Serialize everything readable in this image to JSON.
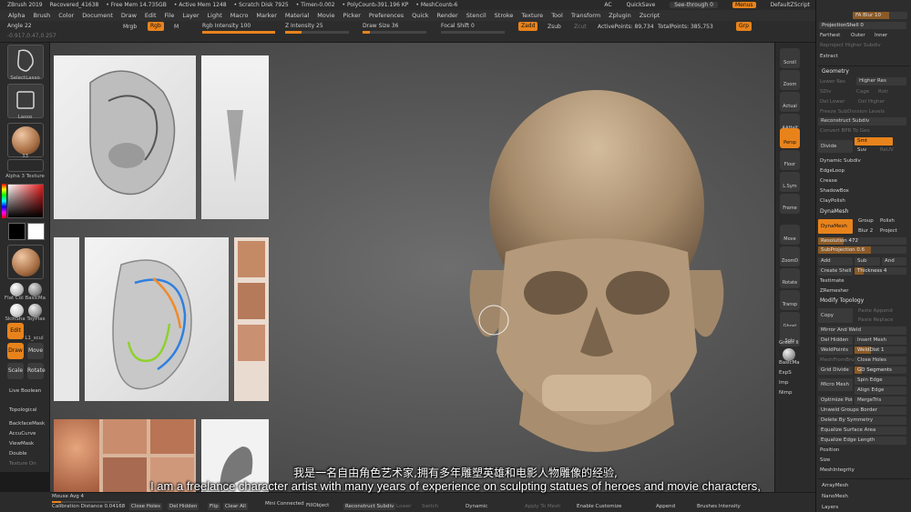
{
  "titlebar": {
    "items": [
      "ZBrush 2019",
      "Recovered_41638",
      "• Free Mem 14.735GB",
      "• Active Mem 1248",
      "• Scratch Disk 7925",
      "• Timer▹0.002",
      "• PolyCount▹391.196 KP",
      "• MeshCount▹6"
    ],
    "ac": "AC",
    "quicksave": "QuickSave",
    "see_through": "See-through  0",
    "menus": "Menus",
    "script": "DefaultZScript"
  },
  "menubar": [
    "Alpha",
    "Brush",
    "Color",
    "Document",
    "Draw",
    "Edit",
    "File",
    "Layer",
    "Light",
    "Macro",
    "Marker",
    "Material",
    "Movie",
    "Picker",
    "Preferences",
    "Quick",
    "Render",
    "Stencil",
    "Stroke",
    "Texture",
    "Tool",
    "Transform",
    "Zplugin",
    "Zscript"
  ],
  "toolbar": {
    "angle": "Angle 22",
    "coords": "-0.917,0.47,0.257",
    "mrgb": "Mrgb",
    "rgb": "Rgb",
    "m": "M",
    "rgb_intensity": "Rgb Intensity 100",
    "rgb_intensity_value": 100,
    "z_intensity": "Z Intensity 25",
    "z_intensity_value": 25,
    "draw_size": "Draw Size 36",
    "focal_shift": "Focal Shift 0",
    "zadd": "Zadd",
    "zsub": "Zsub",
    "zcut": "Zcut",
    "active_points": "ActivePoints: 89,734",
    "total_points": "TotalPoints: 385,753",
    "grp": "Grp"
  },
  "left_shelf": {
    "select_lasso": "SelectLasso",
    "lasso": "Lasso",
    "stroke_count": "33",
    "alpha_label": "Alpha 3 Texture",
    "material_label": "Flat Col BasicMa",
    "material2_label": "SkinSha ToyPlas",
    "model_label": "L1_scul",
    "edit": "Edit",
    "draw": "Draw",
    "move": "Move",
    "scale": "Scale",
    "rotate": "Rotate",
    "live_boolean": "Live Boolean",
    "topological": "Topological",
    "backface_mask": "BackfaceMask",
    "accucurve": "AccuCurve",
    "viewmask": "ViewMask",
    "double": "Double",
    "texture_on": "Texture On"
  },
  "right_shelf": {
    "items": [
      "Scroll",
      "Zoom",
      "Actual",
      "AAHalf",
      "Persp",
      "Floor",
      "L.Sym",
      "Frame",
      "Move",
      "ZoomD",
      "Rotate",
      "Transp",
      "Ghost",
      "Solo"
    ],
    "green_label": "Green II",
    "basic_label": "BasicMa",
    "expl": "ExpS",
    "imp": "Imp",
    "nimp": "Nimp"
  },
  "right_panel": {
    "fablur": "FA Blur 10",
    "projection_shell": "ProjectionShell 0",
    "farthest": "Farthest",
    "outer": "Outer",
    "inner": "Inner",
    "reproject": "Reproject Higher Subdiv",
    "extract": "Extract",
    "geometry": "Geometry",
    "lower_res": "Lower Res",
    "higher_res": "Higher Res",
    "sdiv": "SDiv",
    "cage": "Cage",
    "rstr": "Rstr",
    "del_lower": "Del Lower",
    "del_higher": "Del Higher",
    "freeze": "Freeze SubDivision Levels",
    "reconstruct": "Reconstruct Subdiv",
    "convert_bpr": "Convert BPR To Geo",
    "divide": "Divide",
    "smt": "Smt",
    "suv": "Suv",
    "reuv": "ReUV",
    "dynamic_subdiv": "Dynamic Subdiv",
    "edgeloop": "EdgeLoop",
    "crease": "Crease",
    "shadowbox": "ShadowBox",
    "claypolish": "ClayPolish",
    "dynamesh": "DynaMesh",
    "dynamesh_btn": "DynaMesh",
    "group": "Group",
    "polish": "Polish",
    "blur": "Blur 2",
    "project": "Project",
    "resolution": "Resolution 472",
    "resolution_value": 472,
    "subprojection": "SubProjection 0.6",
    "subprojection_value": 0.6,
    "add": "Add",
    "sub": "Sub",
    "and": "And",
    "create_shell": "Create Shell",
    "thickness": "Thickness 4",
    "testimate": "Testimate",
    "zremesher": "ZRemesher",
    "modify_topology": "Modify Topology",
    "copy": "Copy",
    "paste_append": "Paste Append",
    "paste_replace": "Paste Replace",
    "mirror_weld": "Mirror And Weld",
    "del_hidden": "Del Hidden",
    "insert_mesh": "Insert Mesh",
    "weldpoints": "WeldPoints",
    "welddist": "WeldDist 1",
    "meshfrombrush": "MeshFromBrush",
    "close_holes": "Close Holes",
    "grid_divide": "Grid Divide",
    "gd_segments": "GD Segments",
    "micro_mesh": "Micro Mesh",
    "spin_edge": "Spin Edge",
    "align_edge": "Align Edge",
    "optimize_points": "Optimize Points",
    "mergetris": "MergeTris",
    "unweld_groups": "Unweld Groups Border",
    "delete_by_symmetry": "Delete By Symmetry",
    "equalize_surface": "Equalize Surface Area",
    "equalize_edge": "Equalize Edge Length",
    "position": "Position",
    "size": "Size",
    "meshintegrity": "MeshIntegrity",
    "arraymesh": "ArrayMesh",
    "nanomesh": "NanoMesh",
    "layers": "Layers"
  },
  "bottombar": {
    "mouse_avg": "Mouse Avg 4",
    "calibration": "Calibration Distance 0.04168",
    "close_holes": "Close Holes",
    "del_hidden": "Del Hidden",
    "flip": "Flip",
    "clear_all": "Clear All",
    "mini_connected": "Mini Connected",
    "fill_object": "FillObject",
    "reconstruct": "Reconstruct Subdiv",
    "lower": "Lower",
    "switch": "Switch",
    "dynamic": "Dynamic",
    "apply_to_mesh": "Apply To Mesh",
    "enable_customize": "Enable Customize",
    "append": "Append",
    "brushes_intensity": "Brushes Intensity"
  },
  "subtitles": {
    "chinese": "我是一名自由角色艺术家,拥有多年雕塑英雄和电影人物雕像的经验,",
    "english": "I am a freelance character artist with many years of experience on sculpting statues of heroes and movie characters,"
  },
  "colors": {
    "accent": "#e8831c",
    "panel": "#2d2d2d",
    "skull": "#b79e80"
  }
}
